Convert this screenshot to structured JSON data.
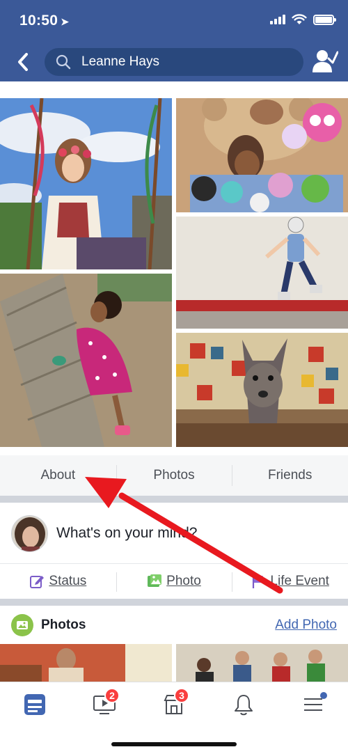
{
  "status_bar": {
    "time": "10:50",
    "location_icon": "location-arrow-icon"
  },
  "header": {
    "search_value": "Leanne Hays",
    "back_icon": "chevron-left-icon",
    "friend_icon": "friend-request-icon"
  },
  "colors": {
    "brand": "#3b5998",
    "search_bg": "#29487d",
    "badge": "#fa3e3e",
    "link": "#4267b2",
    "annotation_arrow": "#e8191f"
  },
  "profile_tabs": [
    {
      "label": "About"
    },
    {
      "label": "Photos"
    },
    {
      "label": "Friends"
    }
  ],
  "composer": {
    "prompt": "What's on your mind?",
    "actions": [
      {
        "label": "Status",
        "icon": "edit-icon"
      },
      {
        "label": "Photo",
        "icon": "photo-icon"
      },
      {
        "label": "Life Event",
        "icon": "flag-icon"
      }
    ]
  },
  "photos_section": {
    "title": "Photos",
    "add_label": "Add Photo"
  },
  "bottom_nav": [
    {
      "name": "news-feed",
      "icon": "news-feed-icon",
      "badge": null,
      "active": true
    },
    {
      "name": "watch",
      "icon": "video-icon",
      "badge": "2"
    },
    {
      "name": "marketplace",
      "icon": "store-icon",
      "badge": "3"
    },
    {
      "name": "notifications",
      "icon": "bell-icon",
      "badge": null
    },
    {
      "name": "menu",
      "icon": "menu-icon",
      "badge": null,
      "dot": true
    }
  ]
}
